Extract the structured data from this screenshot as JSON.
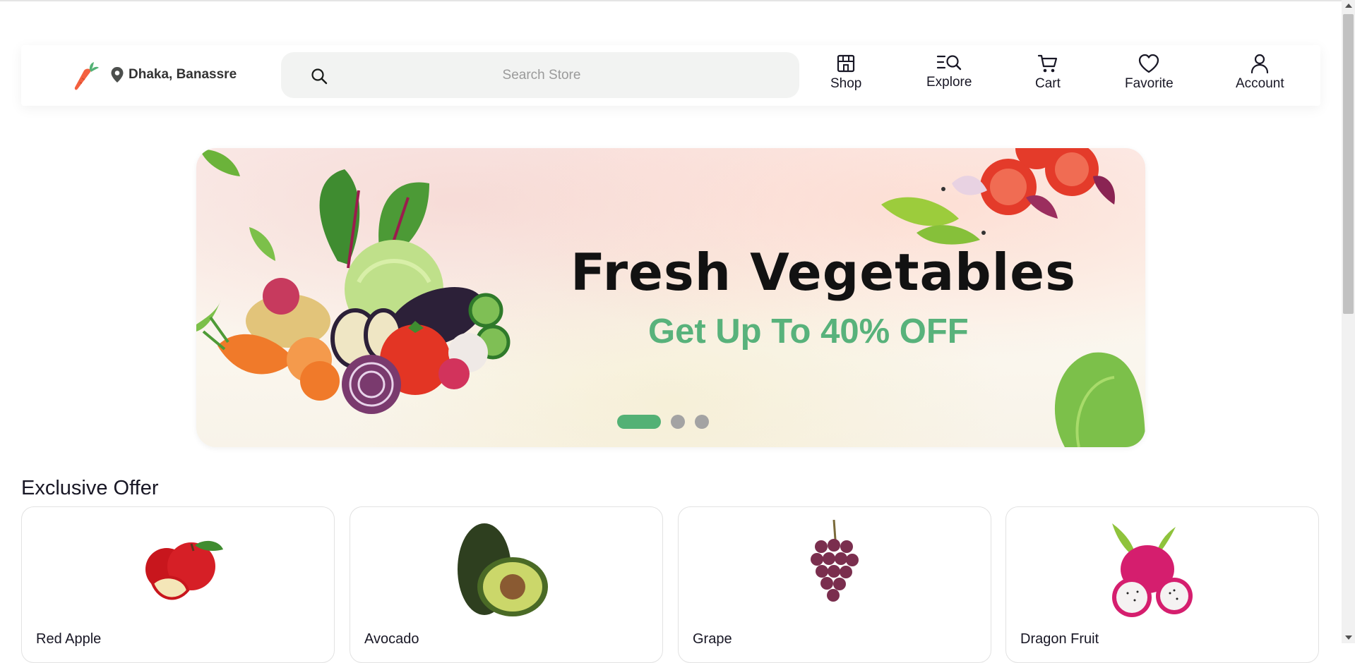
{
  "header": {
    "location": "Dhaka, Banassre",
    "search_placeholder": "Search Store",
    "nav": {
      "shop": "Shop",
      "explore": "Explore",
      "cart": "Cart",
      "favorite": "Favorite",
      "account": "Account"
    }
  },
  "banner": {
    "title": "Fresh Vegetables",
    "subtitle": "Get Up To 40% OFF",
    "slides": 3,
    "active_slide": 1
  },
  "offers": {
    "title": "Exclusive Offer",
    "items": [
      {
        "name": "Red Apple",
        "icon": "red-apple-image"
      },
      {
        "name": "Avocado",
        "icon": "avocado-image"
      },
      {
        "name": "Grape",
        "icon": "grape-image"
      },
      {
        "name": "Dragon Fruit",
        "icon": "dragon-fruit-image"
      }
    ]
  },
  "colors": {
    "accent": "#53b175",
    "banner_subtitle": "#58b27b",
    "text": "#181725"
  }
}
